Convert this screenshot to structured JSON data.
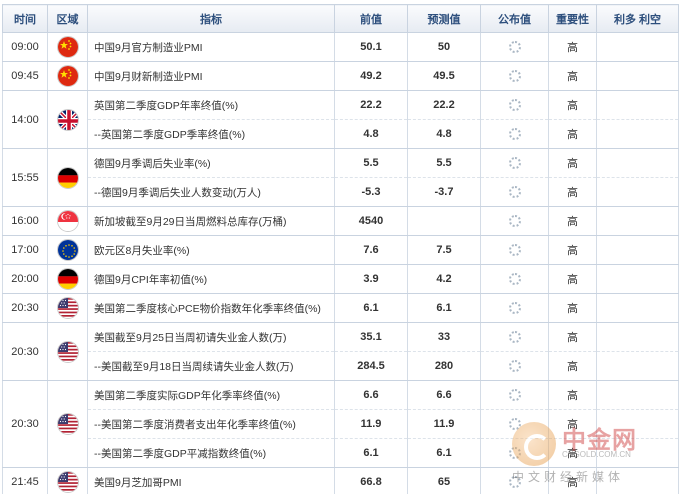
{
  "headers": {
    "time": "时间",
    "region": "区域",
    "indicator": "指标",
    "previous": "前值",
    "forecast": "预测值",
    "actual": "公布值",
    "importance": "重要性",
    "impact": "利多 利空"
  },
  "rows": [
    {
      "time": "09:00",
      "flag": "china-flag",
      "indicator": "中国9月官方制造业PMI",
      "previous": "50.1",
      "forecast": "50",
      "importance": "高"
    },
    {
      "time": "09:45",
      "flag": "china-flag",
      "indicator": "中国9月财新制造业PMI",
      "previous": "49.2",
      "forecast": "49.5",
      "importance": "高"
    },
    {
      "time": "14:00",
      "flag": "uk-flag",
      "indicator": "英国第二季度GDP年率终值(%)",
      "previous": "22.2",
      "forecast": "22.2",
      "importance": "高"
    },
    {
      "indicator": "--英国第二季度GDP季率终值(%)",
      "previous": "4.8",
      "forecast": "4.8",
      "importance": "高"
    },
    {
      "time": "15:55",
      "flag": "germany-flag",
      "indicator": "德国9月季调后失业率(%)",
      "previous": "5.5",
      "forecast": "5.5",
      "importance": "高"
    },
    {
      "indicator": "--德国9月季调后失业人数变动(万人)",
      "previous": "-5.3",
      "forecast": "-3.7",
      "importance": "高"
    },
    {
      "time": "16:00",
      "flag": "singapore-flag",
      "indicator": "新加坡截至9月29日当周燃料总库存(万桶)",
      "previous": "4540",
      "forecast": "",
      "importance": "高"
    },
    {
      "time": "17:00",
      "flag": "eu-flag",
      "indicator": "欧元区8月失业率(%)",
      "previous": "7.6",
      "forecast": "7.5",
      "importance": "高"
    },
    {
      "time": "20:00",
      "flag": "germany-flag",
      "indicator": "德国9月CPI年率初值(%)",
      "previous": "3.9",
      "forecast": "4.2",
      "importance": "高"
    },
    {
      "time": "20:30",
      "flag": "us-flag",
      "indicator": "美国第二季度核心PCE物价指数年化季率终值(%)",
      "previous": "6.1",
      "forecast": "6.1",
      "importance": "高"
    },
    {
      "time": "20:30",
      "flag": "us-flag",
      "indicator": "美国截至9月25日当周初请失业金人数(万)",
      "previous": "35.1",
      "forecast": "33",
      "importance": "高"
    },
    {
      "indicator": "--美国截至9月18日当周续请失业金人数(万)",
      "previous": "284.5",
      "forecast": "280",
      "importance": "高"
    },
    {
      "time": "20:30",
      "flag": "us-flag",
      "indicator": "美国第二季度实际GDP年化季率终值(%)",
      "previous": "6.6",
      "forecast": "6.6",
      "importance": "高"
    },
    {
      "indicator": "--美国第二季度消费者支出年化季率终值(%)",
      "previous": "11.9",
      "forecast": "11.9",
      "importance": "高"
    },
    {
      "indicator": "--美国第二季度GDP平减指数终值(%)",
      "previous": "6.1",
      "forecast": "6.1",
      "importance": "高"
    },
    {
      "time": "21:45",
      "flag": "us-flag",
      "indicator": "美国9月芝加哥PMI",
      "previous": "66.8",
      "forecast": "65",
      "importance": "高"
    }
  ],
  "watermark": {
    "name": "中金网",
    "url": "CNGOLD.COM.CN",
    "tagline": "中文财经新媒体"
  }
}
